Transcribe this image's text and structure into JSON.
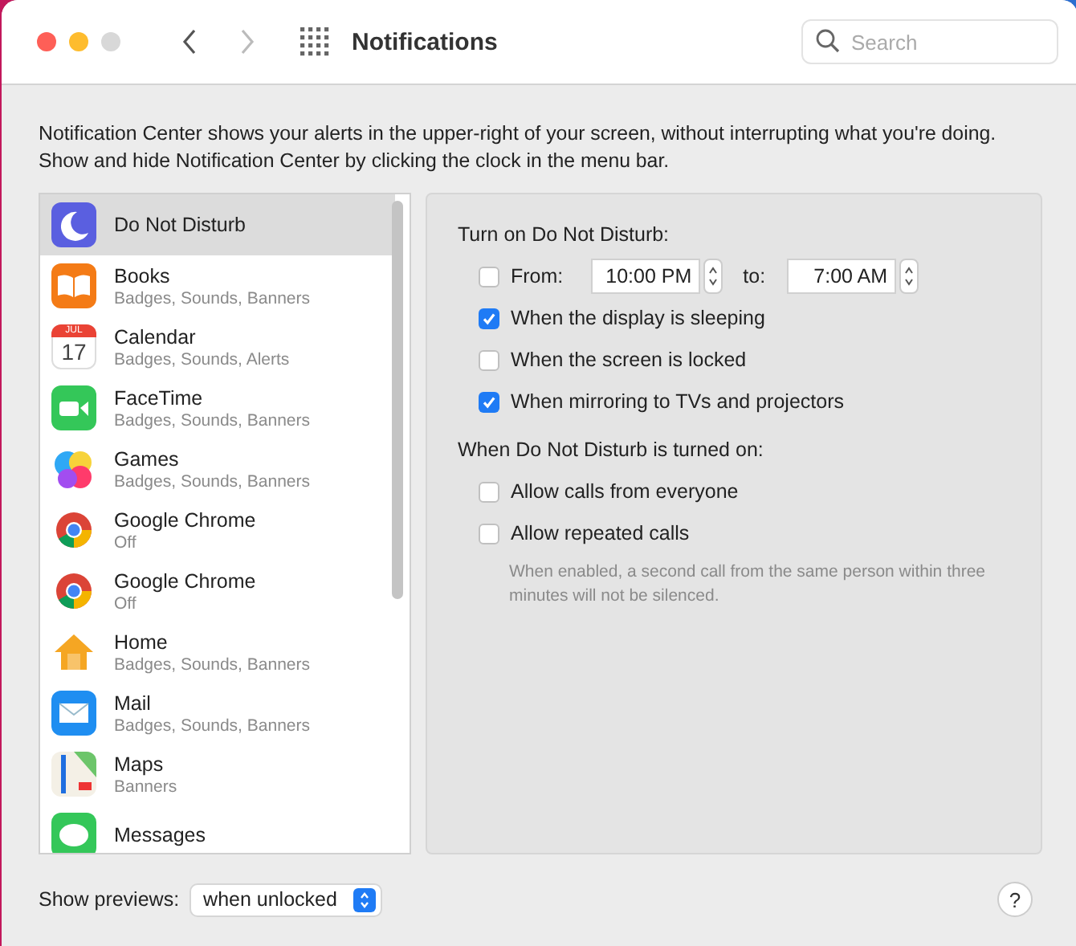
{
  "window": {
    "title": "Notifications",
    "search": {
      "placeholder": "Search"
    }
  },
  "description": "Notification Center shows your alerts in the upper-right of your screen, without interrupting what you're doing. Show and hide Notification Center by clicking the clock in the menu bar.",
  "apps": [
    {
      "name": "Do Not Disturb",
      "selected": true
    },
    {
      "name": "Books",
      "subtitle": "Badges, Sounds, Banners",
      "selected": false
    },
    {
      "name": "Calendar",
      "subtitle": "Badges, Sounds, Alerts",
      "icon_month": "JUL",
      "icon_day": "17",
      "selected": false
    },
    {
      "name": "FaceTime",
      "subtitle": "Badges, Sounds, Banners",
      "selected": false
    },
    {
      "name": "Games",
      "subtitle": "Badges, Sounds, Banners",
      "selected": false
    },
    {
      "name": "Google Chrome",
      "subtitle": "Off",
      "selected": false
    },
    {
      "name": "Google Chrome",
      "subtitle": "Off",
      "selected": false
    },
    {
      "name": "Home",
      "subtitle": "Badges, Sounds, Banners",
      "selected": false
    },
    {
      "name": "Mail",
      "subtitle": "Badges, Sounds, Banners",
      "selected": false
    },
    {
      "name": "Maps",
      "subtitle": "Banners",
      "selected": false
    },
    {
      "name": "Messages",
      "selected": false
    }
  ],
  "sections": [
    {
      "title": "Turn on Do Not Disturb:",
      "options": [
        {
          "kind": "time_range",
          "checked": false,
          "label": "From:",
          "from": "10:00 PM",
          "to_label": "to:",
          "to": "7:00 AM"
        },
        {
          "kind": "checkbox",
          "checked": true,
          "label": "When the display is sleeping"
        },
        {
          "kind": "checkbox",
          "checked": false,
          "label": "When the screen is locked"
        },
        {
          "kind": "checkbox",
          "checked": true,
          "label": "When mirroring to TVs and projectors"
        }
      ]
    },
    {
      "title": "When Do Not Disturb is turned on:",
      "options": [
        {
          "kind": "checkbox",
          "checked": false,
          "label": "Allow calls from everyone"
        },
        {
          "kind": "checkbox",
          "checked": false,
          "label": "Allow repeated calls"
        },
        {
          "kind": "note",
          "label": "When enabled, a second call from the same person within three minutes will not be silenced."
        }
      ]
    }
  ],
  "previews": {
    "label": "Show previews:",
    "value": "when unlocked"
  },
  "help": "?"
}
